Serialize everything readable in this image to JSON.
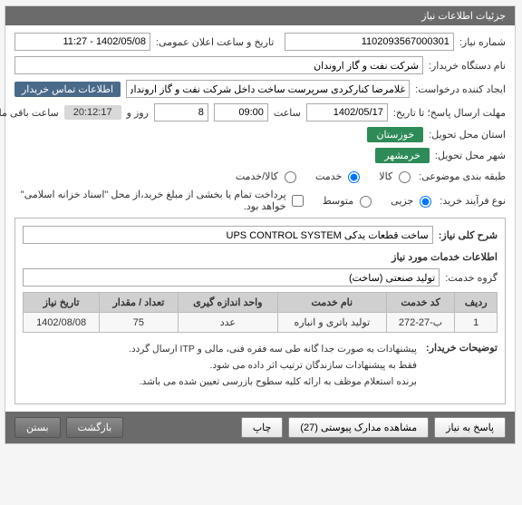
{
  "panel": {
    "title": "جزئیات اطلاعات نیاز"
  },
  "fields": {
    "need_number": {
      "label": "شماره نیاز:",
      "value": "1102093567000301"
    },
    "public_time": {
      "label": "تاریخ و ساعت اعلان عمومی:",
      "value": "1402/05/08 - 11:27"
    },
    "buyer": {
      "label": "نام دستگاه خریدار:",
      "value": "شرکت نفت و گاز اروندان"
    },
    "creator": {
      "label": "ایجاد کننده درخواست:",
      "value": "غلامرضا کنارکردی سرپرست ساخت داخل شرکت نفت و گاز اروندان"
    },
    "contact": "اطلاعات تماس خریدار",
    "deadline": {
      "label": "مهلت ارسال پاسخ؛ تا تاریخ:",
      "date": "1402/05/17",
      "time_lbl": "ساعت",
      "time": "09:00",
      "days_lbl": "روز و",
      "days": "8",
      "remain_lbl": "ساعت باقی مانده",
      "remain": "20:12:17"
    },
    "province": {
      "label": "استان محل تحویل:",
      "value": "خوزستان"
    },
    "city": {
      "label": "شهر محل تحویل:",
      "value": "خرمشهر"
    },
    "subject_cls": {
      "label": "طبقه بندی موضوعی:",
      "options": [
        {
          "label": "کالا",
          "checked": false
        },
        {
          "label": "خدمت",
          "checked": true
        },
        {
          "label": "کالا/خدمت",
          "checked": false
        }
      ]
    },
    "buy_type": {
      "label": "نوع فرآیند خرید:",
      "options": [
        {
          "label": "جزیی",
          "checked": true
        },
        {
          "label": "متوسط",
          "checked": false
        }
      ],
      "note": "پرداخت تمام یا بخشی از مبلغ خرید،از محل \"اسناد خزانه اسلامی\" خواهد بود."
    },
    "subject": {
      "label": "شرح کلی نیاز:",
      "value": "ساخت قطعات یدکی UPS CONTROL SYSTEM"
    },
    "services_section": "اطلاعات خدمات مورد نیاز",
    "service_group": {
      "label": "گروه خدمت:",
      "value": "تولید صنعتی (ساخت)"
    },
    "buyer_notes": {
      "label": "توضیحات خریدار:",
      "text": "پیشنهادات به صورت جدا گانه طی سه فقره فنی، مالی و ITP ارسال گردد.\nفقط به پیشنهادات سازندگان ترتیب اثر داده می شود.\nبرنده استعلام موظف به ارائه کلیه سطوح بازرسی تعیین شده می باشد."
    }
  },
  "table": {
    "headers": [
      "ردیف",
      "کد خدمت",
      "نام خدمت",
      "واحد اندازه گیری",
      "تعداد / مقدار",
      "تاریخ نیاز"
    ],
    "rows": [
      {
        "idx": "1",
        "code": "ب-27-272",
        "name": "تولید باتری و انباره",
        "unit": "عدد",
        "qty": "75",
        "date": "1402/08/08"
      }
    ]
  },
  "footer": {
    "reply": "پاسخ به نیاز",
    "attachments": "مشاهده مدارک پیوستی (27)",
    "print": "چاپ",
    "back": "بازگشت",
    "close": "بستن"
  }
}
